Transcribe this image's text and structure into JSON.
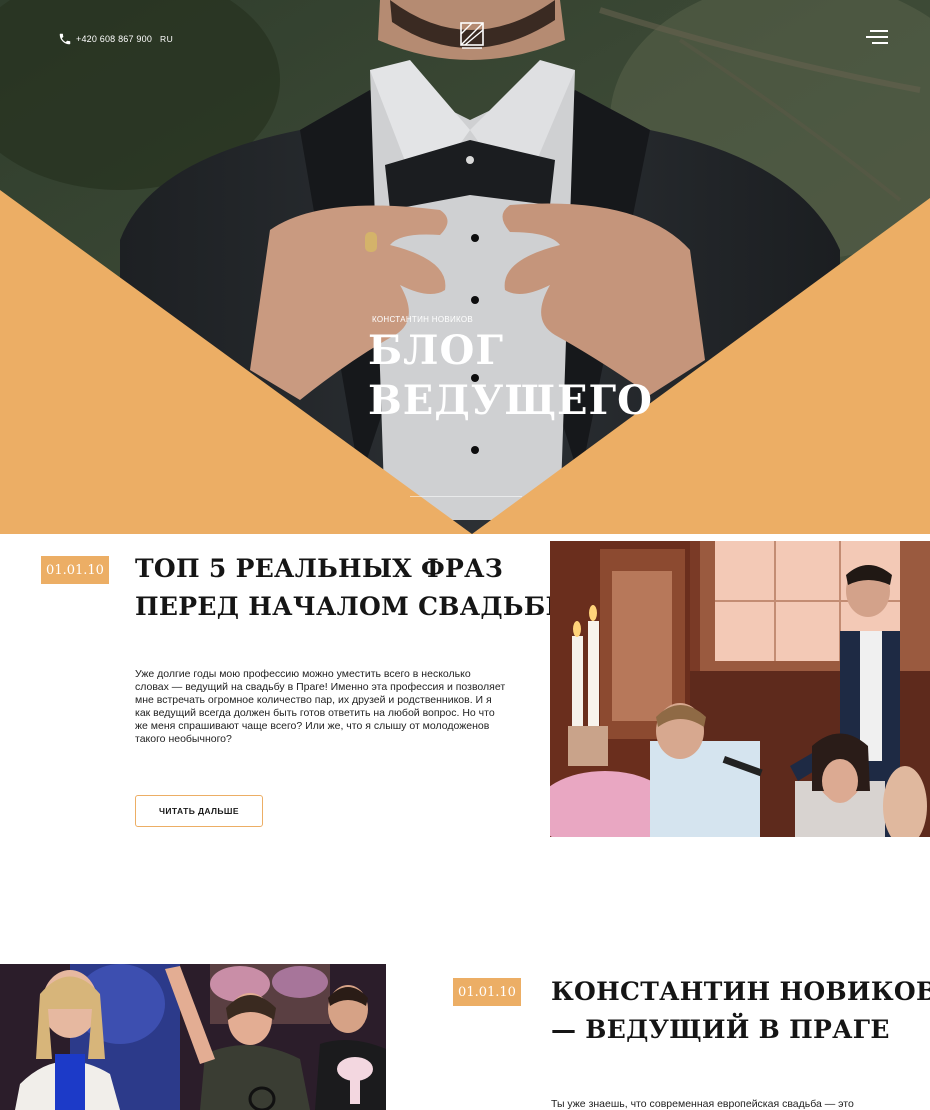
{
  "header": {
    "phone": "+420 608 867 900",
    "language": "RU",
    "logo_icon": "brand-logo-icon",
    "menu_icon": "burger-menu-icon"
  },
  "hero": {
    "subtitle": "КОНСТАНТИН НОВИКОВ",
    "title_line1": "БЛОГ",
    "title_line2": "ВЕДУЩЕГО"
  },
  "colors": {
    "accent": "#ecae65",
    "text": "#151515",
    "background": "#ffffff"
  },
  "posts": [
    {
      "date": "01.01.10",
      "title_line1": "ТОП 5 РЕАЛЬНЫХ ФРАЗ",
      "title_line2": "ПЕРЕД НАЧАЛОМ СВАДЬБЫ",
      "text_lines": [
        "Уже долгие годы мою профессию можно уместить всего в несколько",
        "словах — ведущий на свадьбу в Праге! Именно эта профессия и позволяет",
        "мне встречать огромное количество пар, их друзей и родственников. И я",
        "как ведущий всегда должен быть готов ответить на любой вопрос. Но что",
        "же меня спрашивают чаще всего? Или же, что я слышу от молодоженов",
        "такого необычного?"
      ],
      "button": "ЧИТАТЬ ДАЛЬШЕ"
    },
    {
      "date": "01.01.10",
      "title_line1": "КОНСТАНТИН НОВИКОВ",
      "title_line2": "— ВЕДУЩИЙ В ПРАГЕ",
      "text_lines": [
        "Ты уже знаешь, что современная европейская свадьба — это"
      ]
    }
  ]
}
